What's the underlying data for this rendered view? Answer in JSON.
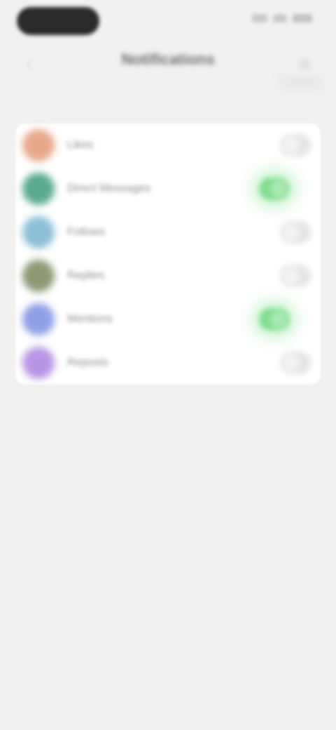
{
  "header": {
    "title": "Notifications"
  },
  "colors": {
    "background": "#f2f1ef",
    "card": "#ffffff",
    "toggle_on": "#7fdc8e",
    "toggle_off": "#e4e4e4"
  },
  "list": {
    "items": [
      {
        "label": "Likes",
        "icon_color": "#e8a88a",
        "enabled": false
      },
      {
        "label": "Direct Messages",
        "icon_color": "#5aaa8e",
        "enabled": true
      },
      {
        "label": "Follows",
        "icon_color": "#8cc0d6",
        "enabled": false
      },
      {
        "label": "Replies",
        "icon_color": "#8e9a76",
        "enabled": false
      },
      {
        "label": "Mentions",
        "icon_color": "#8fa0e8",
        "enabled": true
      },
      {
        "label": "Reposts",
        "icon_color": "#b896e6",
        "enabled": false
      }
    ]
  }
}
